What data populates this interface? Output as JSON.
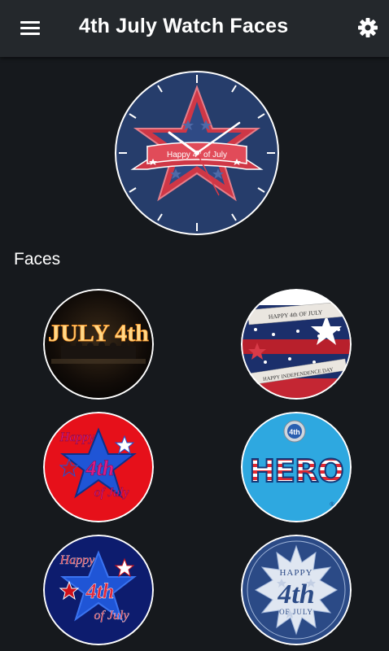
{
  "appbar": {
    "title": "4th July Watch Faces",
    "menu_icon": "hamburger-menu-icon",
    "settings_icon": "gear-icon"
  },
  "preview": {
    "banner_text_pre": "Happy 4",
    "banner_text_sup": "th",
    "banner_text_post": " of July"
  },
  "section": {
    "title": "Faces"
  },
  "faces": [
    {
      "text": "JULY 4th"
    },
    {
      "banner_top": "HAPPY 4th OF JULY",
      "banner_bottom": "HAPPY INDEPENDENCE DAY"
    },
    {
      "line1": "Happy",
      "line2": "4th",
      "line3": "of July"
    },
    {
      "badge": "4th",
      "word": "HERO",
      "mark": "®"
    },
    {
      "line1": "Happy",
      "line2": "4th",
      "line3": "of July"
    },
    {
      "line1": "HAPPY",
      "line2": "4th",
      "line3": "OF JULY"
    }
  ],
  "colors": {
    "appbar_bg": "#24282c",
    "page_bg": "#16191d",
    "navy": "#263d6b",
    "red": "#d93a48",
    "flag_blue": "#2a5fb0"
  }
}
